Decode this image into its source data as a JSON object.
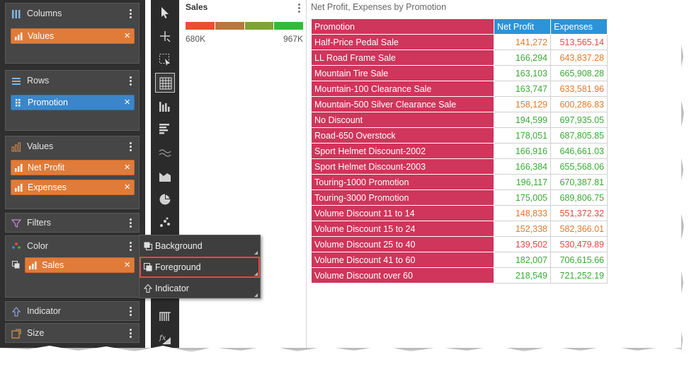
{
  "wells": {
    "columns": {
      "title": "Columns",
      "chips": [
        {
          "label": "Values"
        }
      ]
    },
    "rows": {
      "title": "Rows",
      "chips": [
        {
          "label": "Promotion"
        }
      ]
    },
    "values": {
      "title": "Values",
      "chips": [
        {
          "label": "Net Profit"
        },
        {
          "label": "Expenses"
        }
      ]
    },
    "filters": {
      "title": "Filters"
    },
    "color": {
      "title": "Color",
      "chips": [
        {
          "label": "Sales"
        }
      ]
    },
    "indicator": {
      "title": "Indicator"
    },
    "size": {
      "title": "Size"
    }
  },
  "context_menu": {
    "items": [
      {
        "label": "Background"
      },
      {
        "label": "Foreground"
      },
      {
        "label": "Indicator"
      }
    ]
  },
  "legend": {
    "title": "Sales",
    "min": "680K",
    "max": "967K",
    "colors": [
      "#e9502f",
      "#b9773d",
      "#7fa435",
      "#34ba3b"
    ]
  },
  "grid": {
    "title": "Net Profit, Expenses by Promotion",
    "headers": [
      "Promotion",
      "Net Profit",
      "Expenses"
    ],
    "header_colors": {
      "promotion": "#d0355b",
      "measures": "#2d93d8"
    },
    "rows": [
      {
        "promotion": "Half-Price Pedal Sale",
        "net_profit": "141,272",
        "expenses": "513,565.14",
        "np_color": "orange",
        "ex_color": "red"
      },
      {
        "promotion": "LL Road Frame Sale",
        "net_profit": "166,294",
        "expenses": "643,837.28",
        "np_color": "green",
        "ex_color": "orange"
      },
      {
        "promotion": "Mountain Tire Sale",
        "net_profit": "163,103",
        "expenses": "665,908.28",
        "np_color": "green",
        "ex_color": "green"
      },
      {
        "promotion": "Mountain-100 Clearance Sale",
        "net_profit": "163,747",
        "expenses": "633,581.96",
        "np_color": "green",
        "ex_color": "orange"
      },
      {
        "promotion": "Mountain-500 Silver Clearance Sale",
        "net_profit": "158,129",
        "expenses": "600,286.83",
        "np_color": "orange",
        "ex_color": "orange"
      },
      {
        "promotion": "No Discount",
        "net_profit": "194,599",
        "expenses": "697,935.05",
        "np_color": "green",
        "ex_color": "green"
      },
      {
        "promotion": "Road-650 Overstock",
        "net_profit": "178,051",
        "expenses": "687,805.85",
        "np_color": "green",
        "ex_color": "green"
      },
      {
        "promotion": "Sport Helmet Discount-2002",
        "net_profit": "166,916",
        "expenses": "646,661.03",
        "np_color": "green",
        "ex_color": "green"
      },
      {
        "promotion": "Sport Helmet Discount-2003",
        "net_profit": "166,384",
        "expenses": "655,568.06",
        "np_color": "green",
        "ex_color": "green"
      },
      {
        "promotion": "Touring-1000 Promotion",
        "net_profit": "196,117",
        "expenses": "670,387.81",
        "np_color": "green",
        "ex_color": "green"
      },
      {
        "promotion": "Touring-3000 Promotion",
        "net_profit": "175,005",
        "expenses": "689,806.75",
        "np_color": "green",
        "ex_color": "green"
      },
      {
        "promotion": "Volume Discount 11 to 14",
        "net_profit": "148,833",
        "expenses": "551,372.32",
        "np_color": "orange",
        "ex_color": "red"
      },
      {
        "promotion": "Volume Discount 15 to 24",
        "net_profit": "152,338",
        "expenses": "582,366.01",
        "np_color": "orange",
        "ex_color": "orange"
      },
      {
        "promotion": "Volume Discount 25 to 40",
        "net_profit": "139,502",
        "expenses": "530,479.89",
        "np_color": "red",
        "ex_color": "red"
      },
      {
        "promotion": "Volume Discount 41 to 60",
        "net_profit": "182,007",
        "expenses": "706,615.66",
        "np_color": "green",
        "ex_color": "green"
      },
      {
        "promotion": "Volume Discount over 60",
        "net_profit": "218,549",
        "expenses": "721,252.19",
        "np_color": "green",
        "ex_color": "green"
      }
    ]
  },
  "toolbar": {
    "tools": [
      "pointer-icon",
      "crosshair-icon",
      "select-box-icon",
      "grid-icon",
      "column-chart-icon",
      "bar-chart-icon",
      "line-chart-icon",
      "area-chart-icon",
      "pie-chart-icon",
      "scatter-chart-icon",
      "kpi-icon",
      "formula-icon"
    ],
    "selected": "grid-icon"
  },
  "colors": {
    "chip_orange": "#e07b39",
    "chip_blue": "#3a86c8",
    "menu_highlight": "#e04a43",
    "green": "#3aaa35",
    "orange": "#e07a2a",
    "red": "#e34843"
  }
}
